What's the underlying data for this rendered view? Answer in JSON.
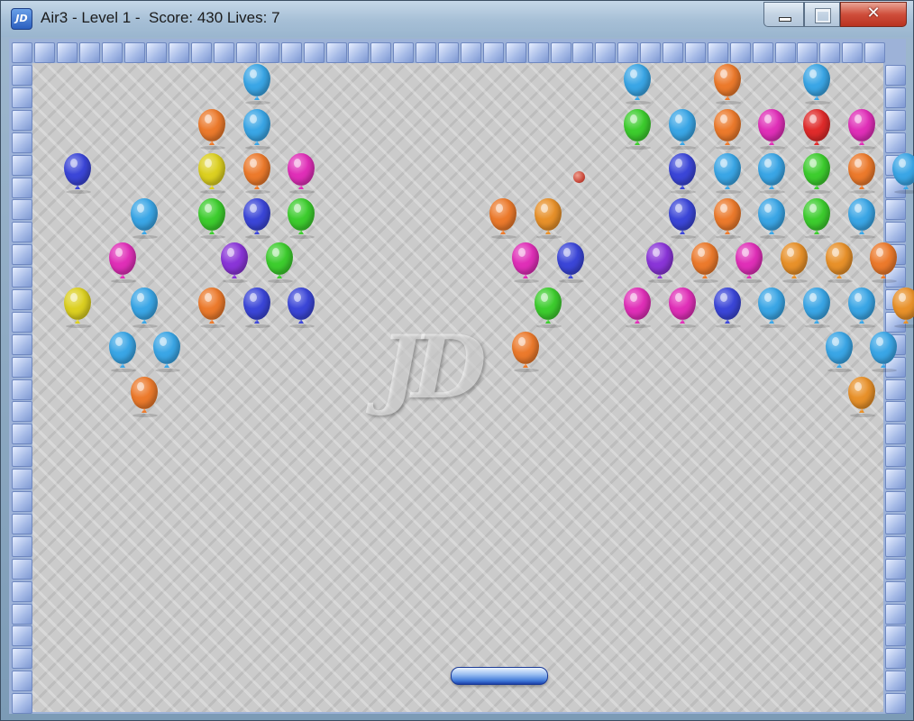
{
  "window": {
    "icon_label": "JD",
    "title": "Air3 - Level 1 -  Score: 430 Lives: 7",
    "minimize_glyph": "—",
    "maximize_glyph": "",
    "close_glyph": "✕"
  },
  "game": {
    "level": 1,
    "score": 430,
    "lives": 7,
    "watermark": "JD",
    "balloon_colors": {
      "blue": "#3aa6e6",
      "orange": "#ec7a2c",
      "purple": "#3b46d8",
      "magenta": "#e02fb8",
      "green": "#3dcd2e",
      "yellow": "#dcd021",
      "red": "#e02b2b",
      "amber": "#e8912a",
      "violet": "#8a35d8"
    },
    "balloons": [
      {
        "color": "blue",
        "row": 0,
        "col": 9
      },
      {
        "color": "orange",
        "row": 1,
        "col": 7
      },
      {
        "color": "blue",
        "row": 1,
        "col": 9
      },
      {
        "color": "purple",
        "row": 2,
        "col": 1
      },
      {
        "color": "yellow",
        "row": 2,
        "col": 7
      },
      {
        "color": "orange",
        "row": 2,
        "col": 9
      },
      {
        "color": "magenta",
        "row": 2,
        "col": 11
      },
      {
        "color": "blue",
        "row": 3,
        "col": 4
      },
      {
        "color": "green",
        "row": 3,
        "col": 7
      },
      {
        "color": "purple",
        "row": 3,
        "col": 9
      },
      {
        "color": "green",
        "row": 3,
        "col": 11
      },
      {
        "color": "magenta",
        "row": 4,
        "col": 3
      },
      {
        "color": "violet",
        "row": 4,
        "col": 8
      },
      {
        "color": "green",
        "row": 4,
        "col": 10
      },
      {
        "color": "yellow",
        "row": 5,
        "col": 1
      },
      {
        "color": "blue",
        "row": 5,
        "col": 4
      },
      {
        "color": "orange",
        "row": 5,
        "col": 7
      },
      {
        "color": "purple",
        "row": 5,
        "col": 9
      },
      {
        "color": "purple",
        "row": 5,
        "col": 11
      },
      {
        "color": "blue",
        "row": 6,
        "col": 3
      },
      {
        "color": "blue",
        "row": 6,
        "col": 5
      },
      {
        "color": "orange",
        "row": 7,
        "col": 4
      },
      {
        "color": "orange",
        "row": 3,
        "col": 20
      },
      {
        "color": "amber",
        "row": 3,
        "col": 22
      },
      {
        "color": "magenta",
        "row": 4,
        "col": 21
      },
      {
        "color": "purple",
        "row": 4,
        "col": 23
      },
      {
        "color": "green",
        "row": 5,
        "col": 22
      },
      {
        "color": "orange",
        "row": 6,
        "col": 21
      },
      {
        "color": "blue",
        "row": 0,
        "col": 26
      },
      {
        "color": "orange",
        "row": 0,
        "col": 30
      },
      {
        "color": "blue",
        "row": 0,
        "col": 34
      },
      {
        "color": "green",
        "row": 1,
        "col": 26
      },
      {
        "color": "blue",
        "row": 1,
        "col": 28
      },
      {
        "color": "orange",
        "row": 1,
        "col": 30
      },
      {
        "color": "magenta",
        "row": 1,
        "col": 32
      },
      {
        "color": "red",
        "row": 1,
        "col": 34
      },
      {
        "color": "magenta",
        "row": 1,
        "col": 36
      },
      {
        "color": "purple",
        "row": 2,
        "col": 28
      },
      {
        "color": "blue",
        "row": 2,
        "col": 30
      },
      {
        "color": "blue",
        "row": 2,
        "col": 32
      },
      {
        "color": "green",
        "row": 2,
        "col": 34
      },
      {
        "color": "orange",
        "row": 2,
        "col": 36
      },
      {
        "color": "blue",
        "row": 2,
        "col": 38
      },
      {
        "color": "purple",
        "row": 3,
        "col": 28
      },
      {
        "color": "orange",
        "row": 3,
        "col": 30
      },
      {
        "color": "blue",
        "row": 3,
        "col": 32
      },
      {
        "color": "green",
        "row": 3,
        "col": 34
      },
      {
        "color": "blue",
        "row": 3,
        "col": 36
      },
      {
        "color": "violet",
        "row": 4,
        "col": 27
      },
      {
        "color": "orange",
        "row": 4,
        "col": 29
      },
      {
        "color": "magenta",
        "row": 4,
        "col": 31
      },
      {
        "color": "amber",
        "row": 4,
        "col": 33
      },
      {
        "color": "amber",
        "row": 4,
        "col": 35
      },
      {
        "color": "orange",
        "row": 4,
        "col": 37
      },
      {
        "color": "magenta",
        "row": 5,
        "col": 26
      },
      {
        "color": "magenta",
        "row": 5,
        "col": 28
      },
      {
        "color": "purple",
        "row": 5,
        "col": 30
      },
      {
        "color": "blue",
        "row": 5,
        "col": 32
      },
      {
        "color": "blue",
        "row": 5,
        "col": 34
      },
      {
        "color": "blue",
        "row": 5,
        "col": 36
      },
      {
        "color": "amber",
        "row": 5,
        "col": 38
      },
      {
        "color": "blue",
        "row": 6,
        "col": 35
      },
      {
        "color": "blue",
        "row": 6,
        "col": 37
      },
      {
        "color": "amber",
        "row": 7,
        "col": 36
      }
    ]
  }
}
